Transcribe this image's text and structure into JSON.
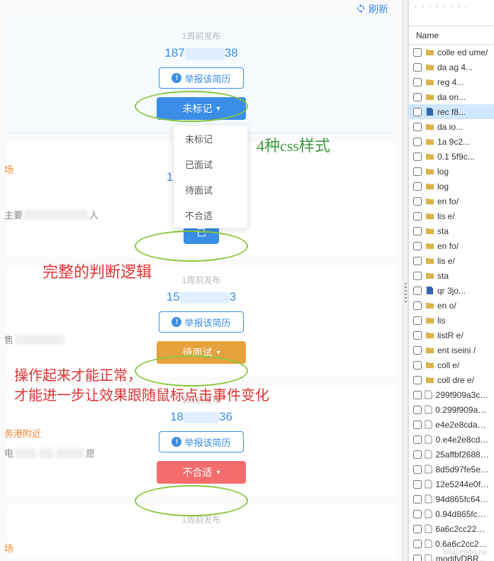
{
  "refresh": {
    "label": "刷新"
  },
  "cards": [
    {
      "time": "1周前发布",
      "phone_prefix": "187",
      "phone_suffix": "38",
      "report": "举报该简历",
      "status": "未标记",
      "status_cls": "blue"
    },
    {
      "time": "",
      "phone_prefix": "156",
      "phone_suffix": "",
      "report": "",
      "status": "已",
      "status_cls": ""
    },
    {
      "time": "1周前发布",
      "phone_prefix": "15",
      "phone_suffix": "3",
      "report": "举报该简历",
      "status": "待面试",
      "status_cls": "orange"
    },
    {
      "time": "1周前发布",
      "phone_prefix": "18",
      "phone_suffix": "36",
      "report": "举报该简历",
      "status": "不合适",
      "status_cls": "red"
    },
    {
      "time": "1周前发布",
      "phone_prefix": "",
      "phone_suffix": "",
      "report": "",
      "status": "",
      "status_cls": ""
    }
  ],
  "dropdown": [
    "未标记",
    "已面试",
    "待面试",
    "不合适"
  ],
  "annotations": {
    "green": "4种css样式",
    "red1": "完整的判断逻辑",
    "red2_l1": "操作起来才能正常，",
    "red2_l2": "才能进一步让效果跟随鼠标点击事件变化"
  },
  "side_bits": {
    "orange1": "场",
    "main": "主要",
    "main_suffix": "人",
    "sale": "售",
    "port": "务港附近",
    "elec": "电",
    "wish": "愿",
    "orange2": "场"
  },
  "right": {
    "header": "Name",
    "rows": [
      {
        "t": "folder",
        "txt": "colle  ed  ume/",
        "sel": false
      },
      {
        "t": "folder",
        "txt": "da  ag  4...",
        "sel": false
      },
      {
        "t": "folder",
        "txt": "reg     4...",
        "sel": false
      },
      {
        "t": "folder",
        "txt": "da       on...",
        "sel": false
      },
      {
        "t": "file2",
        "txt": "rec      f8...",
        "sel": true
      },
      {
        "t": "folder",
        "txt": "da       io...",
        "sel": false
      },
      {
        "t": "folder",
        "txt": "1a       9c2...",
        "sel": false
      },
      {
        "t": "folder",
        "txt": "0.1      5f9c...",
        "sel": false
      },
      {
        "t": "folder",
        "txt": "log",
        "sel": false
      },
      {
        "t": "folder",
        "txt": "log",
        "sel": false
      },
      {
        "t": "folder",
        "txt": "en      fo/",
        "sel": false
      },
      {
        "t": "folder",
        "txt": "lis      e/",
        "sel": false
      },
      {
        "t": "folder",
        "txt": "sta",
        "sel": false
      },
      {
        "t": "folder",
        "txt": "en      fo/",
        "sel": false
      },
      {
        "t": "folder",
        "txt": "lis      e/",
        "sel": false
      },
      {
        "t": "folder",
        "txt": "sta",
        "sel": false
      },
      {
        "t": "file2",
        "txt": "qr       3jo...",
        "sel": false
      },
      {
        "t": "folder",
        "txt": "en      o/",
        "sel": false
      },
      {
        "t": "folder",
        "txt": "lis",
        "sel": false
      },
      {
        "t": "folder",
        "txt": "listR   e/",
        "sel": false
      },
      {
        "t": "folder",
        "txt": "ent   iseini  /",
        "sel": false
      },
      {
        "t": "folder",
        "txt": "coll     e/",
        "sel": false
      },
      {
        "t": "folder",
        "txt": "coll   dre   e/",
        "sel": false
      },
      {
        "t": "file",
        "txt": "299f909a3c0e1...",
        "sel": false
      },
      {
        "t": "file",
        "txt": "0.299f909a3c0e...",
        "sel": false
      },
      {
        "t": "file",
        "txt": "e4e2e8cda4ec3...",
        "sel": false
      },
      {
        "t": "file",
        "txt": "0.e4e2e8cda4e...",
        "sel": false
      },
      {
        "t": "file",
        "txt": "25affbf26881b5...",
        "sel": false
      },
      {
        "t": "file",
        "txt": "8d5d97fe5e2ed...",
        "sel": false
      },
      {
        "t": "file",
        "txt": "12e5244e0f5ff6...",
        "sel": false
      },
      {
        "t": "file",
        "txt": "94d865fc64782...",
        "sel": false
      },
      {
        "t": "file",
        "txt": "0.94d865fc6478...",
        "sel": false
      },
      {
        "t": "file",
        "txt": "6a6c2cc224761...",
        "sel": false
      },
      {
        "t": "file",
        "txt": "0.6a6c2cc22476...",
        "sel": false
      },
      {
        "t": "file",
        "txt": "modifvDBRecu...",
        "sel": false
      }
    ]
  },
  "watermark": "blog.csdn.ne"
}
